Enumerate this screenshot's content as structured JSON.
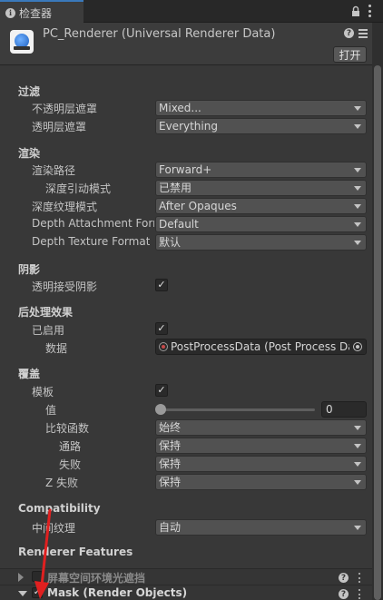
{
  "tab": {
    "label": "检查器"
  },
  "header": {
    "title": "PC_Renderer (Universal Renderer Data)",
    "open_label": "打开"
  },
  "sections": {
    "filtering": {
      "title": "过滤",
      "opaque_label": "不透明层遮罩",
      "opaque_value": "Mixed...",
      "transparent_label": "透明层遮罩",
      "transparent_value": "Everything"
    },
    "rendering": {
      "title": "渲染",
      "path_label": "渲染路径",
      "path_value": "Forward+",
      "depth_priming_label": "深度引动模式",
      "depth_priming_value": "已禁用",
      "depth_texture_mode_label": "深度纹理模式",
      "depth_texture_mode_value": "After Opaques",
      "depth_attachment_label": "Depth Attachment Format",
      "depth_attachment_value": "Default",
      "depth_texture_format_label": "Depth Texture Format",
      "depth_texture_format_value": "默认"
    },
    "shadows": {
      "title": "阴影",
      "transparent_receive_label": "透明接受阴影",
      "transparent_receive_checked": true
    },
    "postprocessing": {
      "title": "后处理效果",
      "enabled_label": "已启用",
      "enabled_checked": true,
      "data_label": "数据",
      "data_value": "PostProcessData (Post Process Data)"
    },
    "overrides": {
      "title": "覆盖",
      "stencil_label": "模板",
      "stencil_checked": true,
      "value_label": "值",
      "value": "0",
      "compare_label": "比较函数",
      "compare_value": "始终",
      "pass_label": "通路",
      "pass_value": "保持",
      "fail_label": "失败",
      "fail_value": "保持",
      "zfail_label": "Z 失败",
      "zfail_value": "保持"
    },
    "compatibility": {
      "title": "Compatibility",
      "intermediate_label": "中间纹理",
      "intermediate_value": "自动"
    },
    "features": {
      "title": "Renderer Features",
      "items": [
        {
          "label": "屏幕空间环境光遮挡",
          "enabled": false,
          "expanded": false
        },
        {
          "label": "Mask (Render Objects)",
          "enabled": true,
          "expanded": true
        }
      ]
    }
  },
  "icons": {
    "tab_info": "info-icon",
    "lock": "lock-icon",
    "menu": "kebab-menu-icon",
    "help": "help-icon",
    "presets": "sliders-icon",
    "object_picker": "object-picker-icon"
  },
  "colors": {
    "annotation_arrow": "#e02020",
    "accent_tab": "#3a79bb"
  }
}
